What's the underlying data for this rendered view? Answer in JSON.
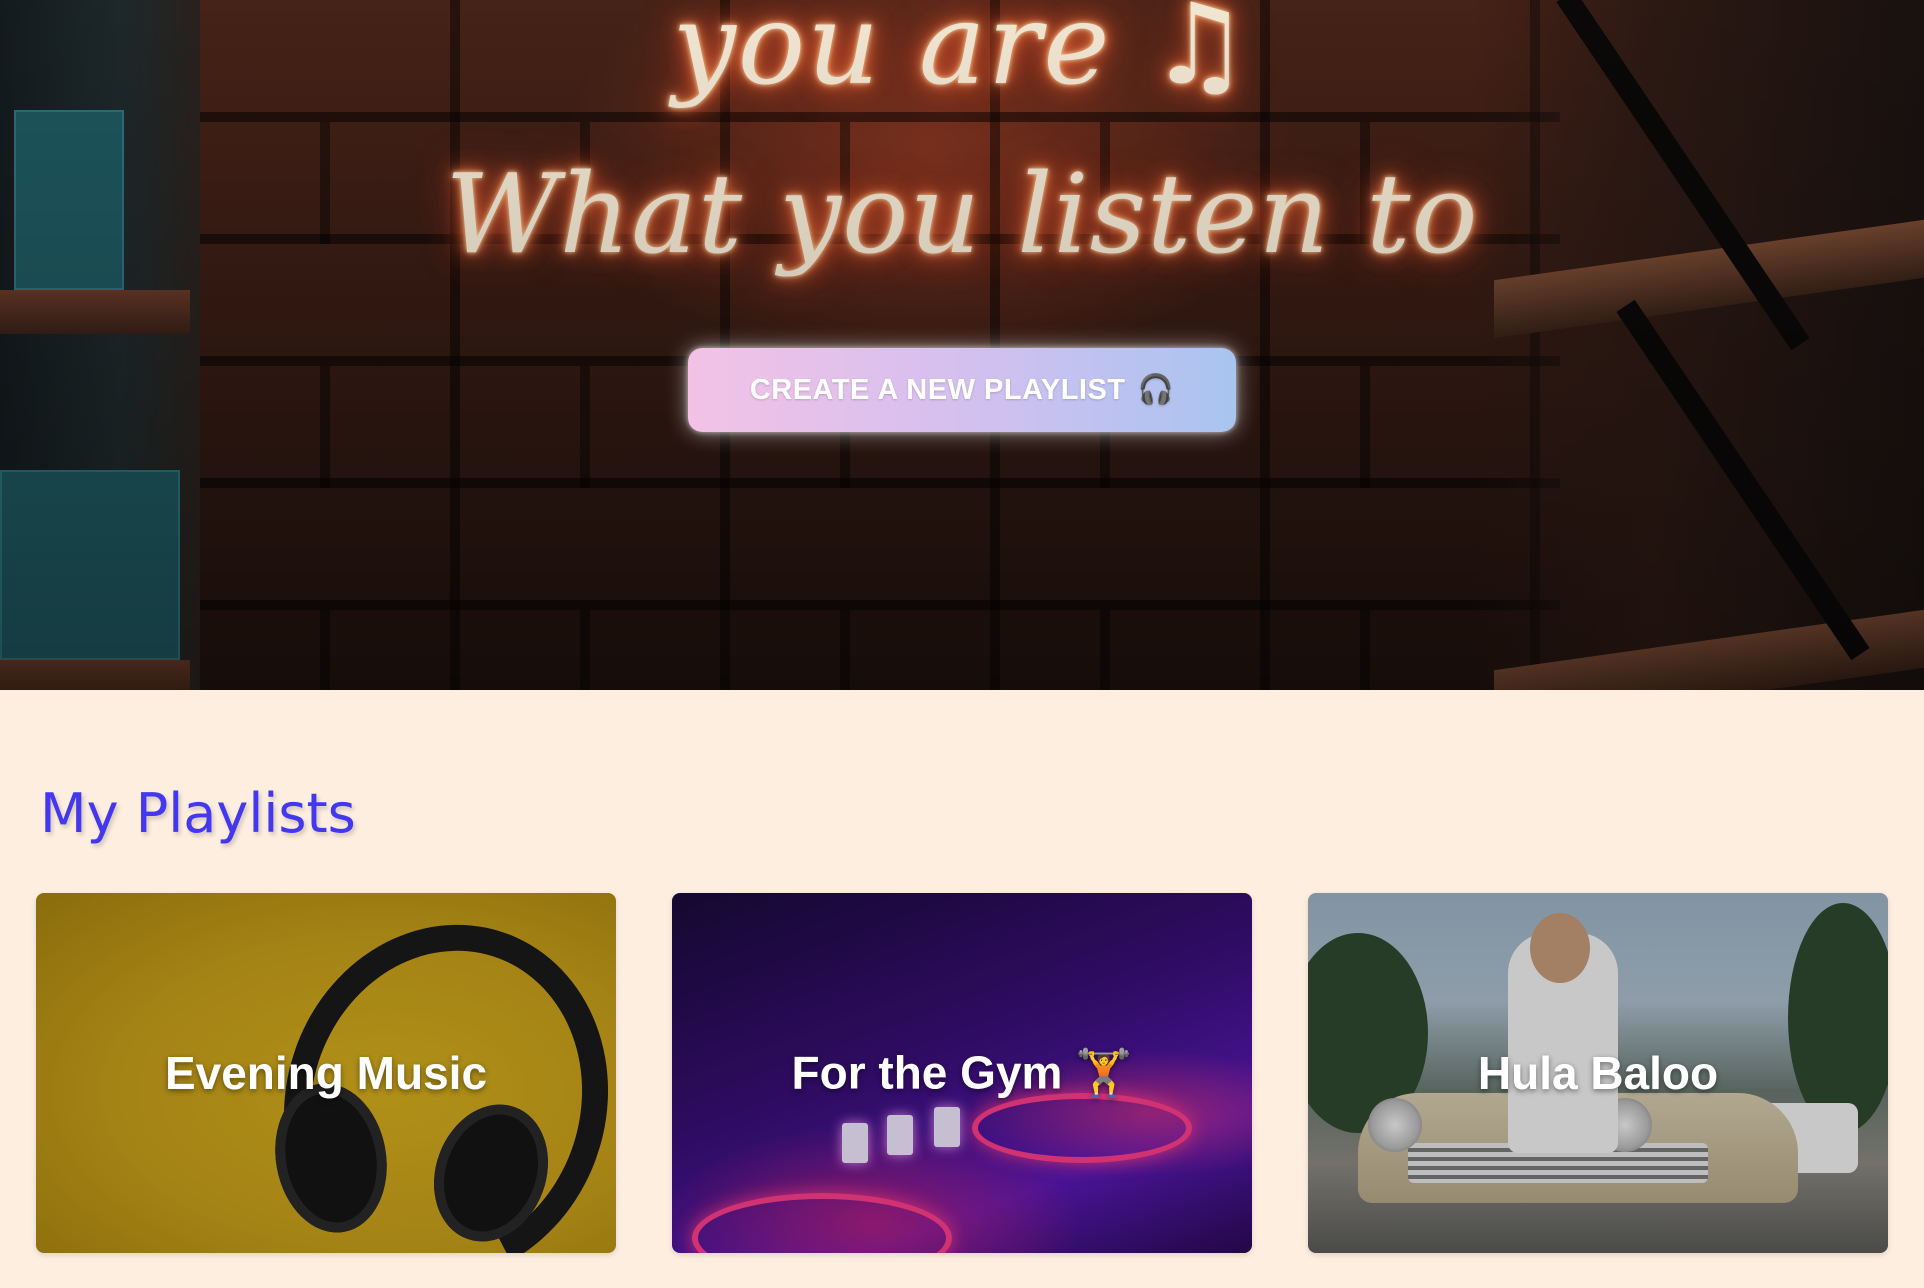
{
  "hero": {
    "neon_line1": "you are ♫",
    "neon_line2": "What you listen to",
    "cta_label": "CREATE A NEW PLAYLIST",
    "cta_icon": "🎧"
  },
  "playlists": {
    "heading": "My Playlists",
    "items": [
      {
        "title": "Evening Music"
      },
      {
        "title": "For the Gym 🏋️"
      },
      {
        "title": "Hula Baloo"
      }
    ]
  },
  "colors": {
    "page_background": "#fdeee0",
    "heading": "#4338f0",
    "cta_gradient_start": "#f3c2e6",
    "cta_gradient_end": "#a9c4f0"
  },
  "icons": {
    "cta": "headphones-icon",
    "gym": "weightlifter-icon"
  }
}
